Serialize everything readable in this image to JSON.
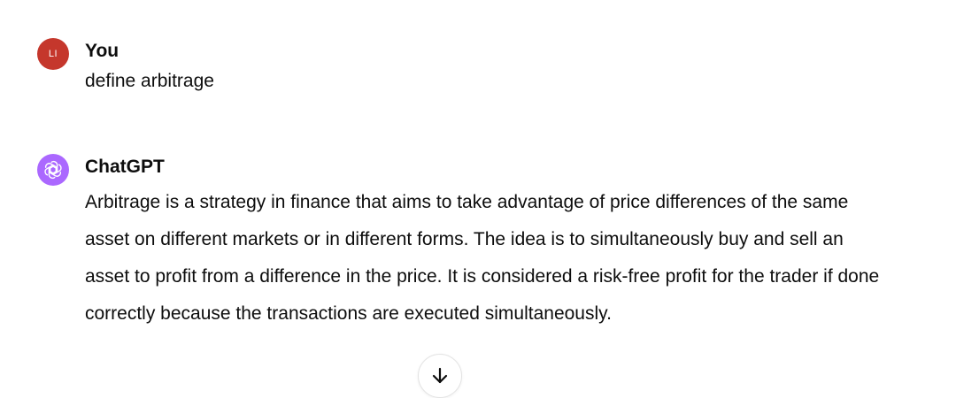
{
  "conversation": {
    "user_message": {
      "avatar_initials": "LI",
      "avatar_color": "#c5372c",
      "author": "You",
      "text": "define arbitrage"
    },
    "assistant_message": {
      "avatar_color": "#ab68ff",
      "avatar_icon": "openai-logo-icon",
      "author": "ChatGPT",
      "text": "Arbitrage is a strategy in finance that aims to take advantage of price differences of the same asset on different markets or in different forms. The idea is to simultaneously buy and sell an asset to profit from a difference in the price. It is considered a risk-free profit for the trader if done correctly because the transactions are executed simultaneously."
    }
  },
  "scroll_button": {
    "icon": "arrow-down-icon"
  }
}
